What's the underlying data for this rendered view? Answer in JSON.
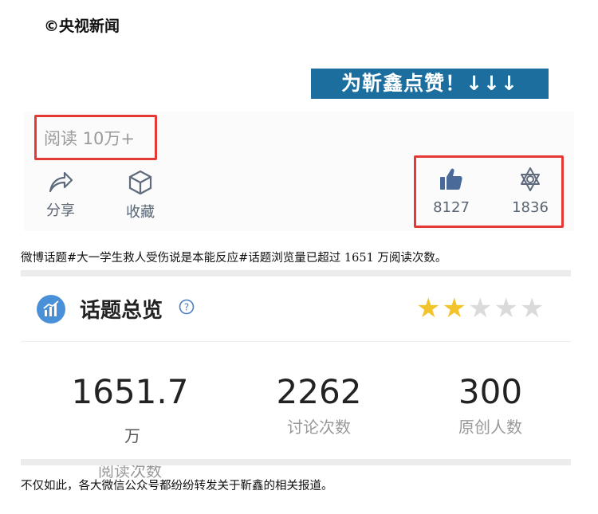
{
  "watermark": "©央视新闻",
  "banner": "为靳鑫点赞！↓↓↓",
  "reads": "阅读  10万+",
  "actions": {
    "share_label": "分享",
    "favorite_label": "收藏"
  },
  "stats": {
    "likes": "8127",
    "second_count": "1836"
  },
  "paragraph1": "微博话题#大一学生救人受伤说是本能反应#话题浏览量已超过 1651 万阅读次数。",
  "topic": {
    "title": "话题总览",
    "rating": 2,
    "rating_max": 5,
    "metrics": [
      {
        "value": "1651.7",
        "unit": "万",
        "label": "阅读次数"
      },
      {
        "value": "2262",
        "unit": "",
        "label": "讨论次数"
      },
      {
        "value": "300",
        "unit": "",
        "label": "原创人数"
      }
    ]
  },
  "paragraph2": "不仅如此，各大微信公众号都纷纷转发关于靳鑫的相关报道。",
  "colors": {
    "banner_bg": "#1b6e9e",
    "highlight_box": "#e53935",
    "star_on": "#f3c32c",
    "star_off": "#dadada",
    "topic_icon": "#4a90d9"
  }
}
